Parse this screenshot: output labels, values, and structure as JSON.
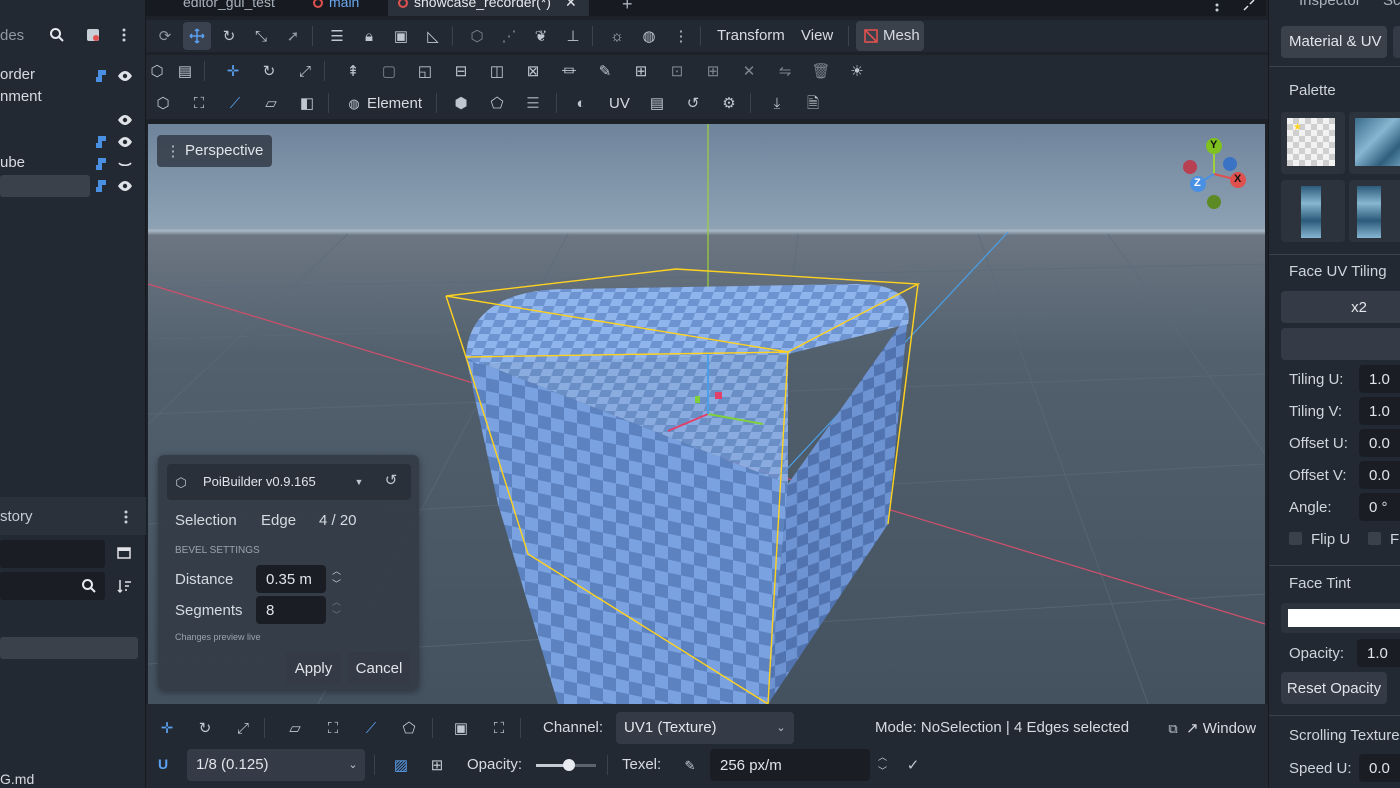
{
  "tabs": [
    {
      "label": "editor_gui_test"
    },
    {
      "label": "main"
    },
    {
      "label": "showcase_recorder(*)"
    }
  ],
  "left_panel": {
    "search_placeholder": "des",
    "tree_items": [
      "order",
      "nment",
      "",
      "",
      "ube",
      ""
    ],
    "history_title": "story",
    "file_label": "G.md"
  },
  "toolbar1": {
    "transform_label": "Transform",
    "view_label": "View",
    "mesh_label": "Mesh"
  },
  "toolbar3": {
    "element_label": "Element",
    "uv_label": "UV"
  },
  "viewport": {
    "perspective_label": "Perspective",
    "gizmo": {
      "y": "Y",
      "x": "X",
      "z": "Z"
    }
  },
  "popup": {
    "title": "PoiBuilder v0.9.165",
    "selection_label": "Selection",
    "selection_mode": "Edge",
    "selection_count": "4 / 20",
    "section_title": "BEVEL SETTINGS",
    "distance_label": "Distance",
    "distance_value": "0.35 m",
    "segments_label": "Segments",
    "segments_value": "8",
    "hint": "Changes preview live",
    "apply_label": "Apply",
    "cancel_label": "Cancel"
  },
  "bottom": {
    "channel_label": "Channel:",
    "channel_value": "UV1 (Texture)",
    "status": "Mode: NoSelection | 4 Edges selected",
    "window_label": "↗ Window",
    "snap_value": "1/8 (0.125)",
    "opacity_label": "Opacity:",
    "opacity_value": 0.55,
    "texel_label": "Texel:",
    "texel_value": "256 px/m"
  },
  "right_panel": {
    "tabs": [
      "Inspector",
      "Sc"
    ],
    "material_tab": "Material & UV",
    "palette_title": "Palette",
    "tiling_title": "Face UV Tiling",
    "x2_label": "x2",
    "tiling_u_label": "Tiling U:",
    "tiling_u_value": "1.0",
    "tiling_v_label": "Tiling V:",
    "tiling_v_value": "1.0",
    "offset_u_label": "Offset U:",
    "offset_u_value": "0.0",
    "offset_v_label": "Offset V:",
    "offset_v_value": "0.0",
    "angle_label": "Angle:",
    "angle_value": "0 °",
    "flip_u_label": "Flip U",
    "flip_v_label": "Fl",
    "tint_title": "Face Tint",
    "tint_color": "#ffffff",
    "opacity_label": "Opacity:",
    "opacity_value": "1.0",
    "reset_opacity_label": "Reset Opacity",
    "scrolling_title": "Scrolling Texture",
    "speed_u_label": "Speed U:",
    "speed_u_value": "0.0"
  },
  "colors": {
    "accent": "#4a90e2",
    "selection": "#ffd21f",
    "mesh_red": "#e0504e"
  }
}
